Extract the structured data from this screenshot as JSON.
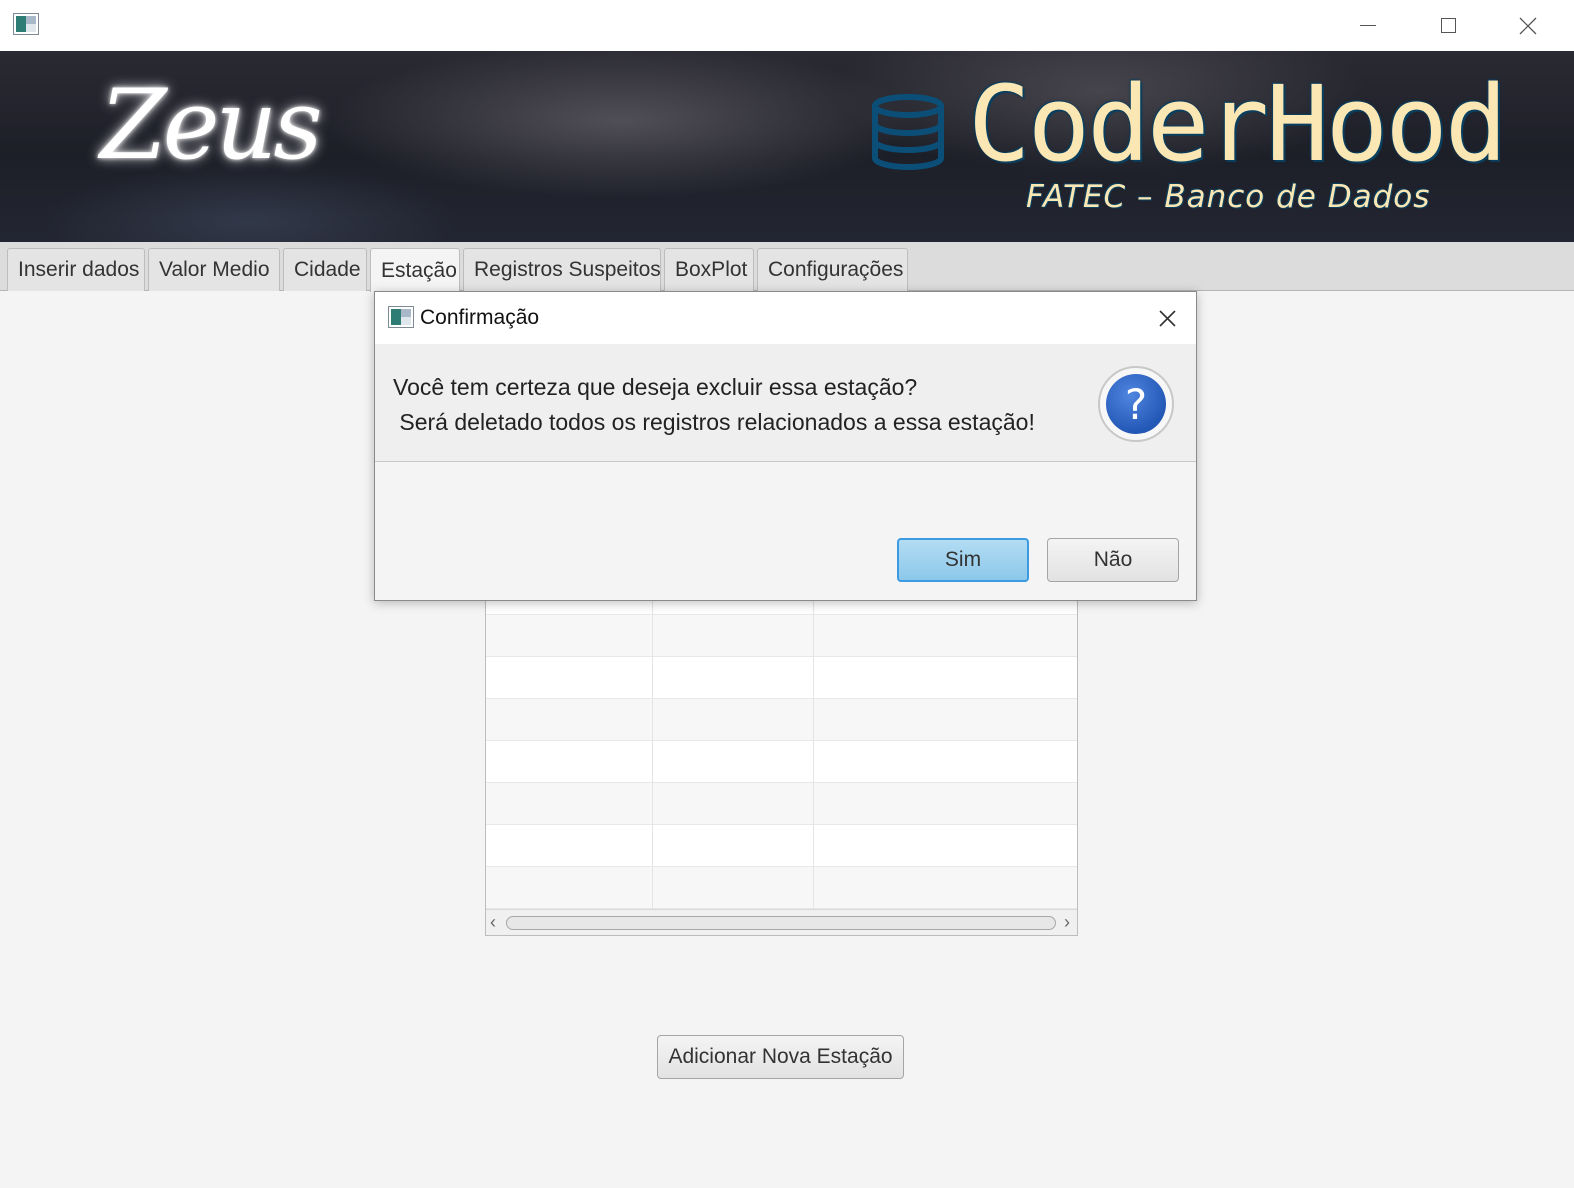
{
  "window": {
    "title_icon": "app-icon",
    "controls": {
      "minimize": "minimize-icon",
      "maximize": "maximize-icon",
      "close": "close-icon"
    }
  },
  "banner": {
    "logo_left": "Zeus",
    "brand": "CoderHood",
    "brand_subtitle": "FATEC – Banco de Dados",
    "brand_icon": "database-icon",
    "brand_color": "#fbe7b4"
  },
  "tabs": [
    {
      "label": "Inserir dados"
    },
    {
      "label": "Valor Medio"
    },
    {
      "label": "Cidade"
    },
    {
      "label": "Estação",
      "selected": true
    },
    {
      "label": "Registros Suspeitos"
    },
    {
      "label": "BoxPlot"
    },
    {
      "label": "Configurações"
    }
  ],
  "main": {
    "add_button_label": "Adicionar Nova Estação"
  },
  "dialog": {
    "title": "Confirmação",
    "message_line1": "Você tem certeza que deseja excluir essa estação?",
    "message_line2": " Será deletado todos os registros relacionados a essa estação!",
    "icon": "question-icon",
    "icon_color": "#2458b7",
    "yes_label": "Sim",
    "no_label": "Não",
    "default_button_color": "#8cc8ea"
  }
}
